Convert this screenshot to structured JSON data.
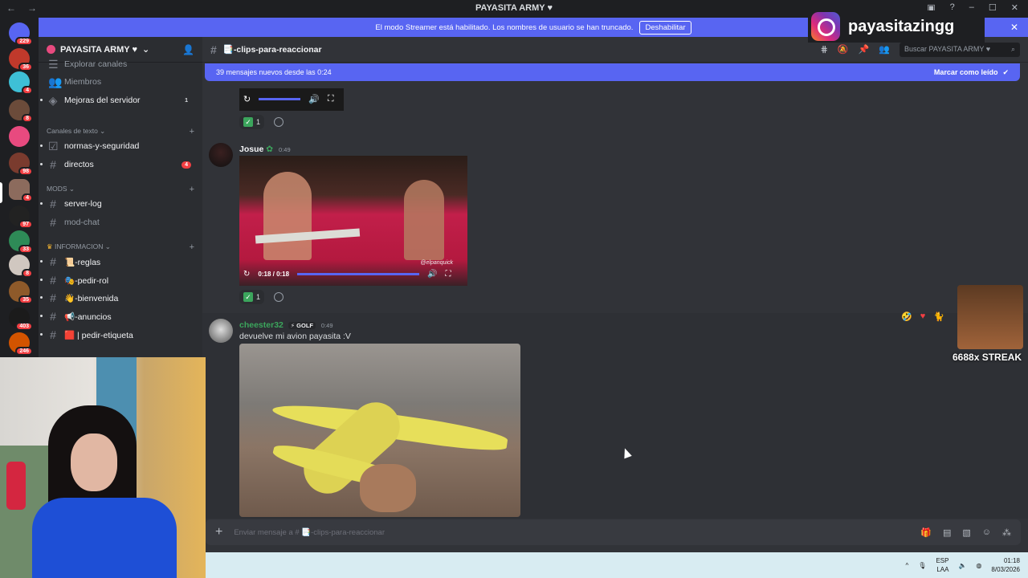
{
  "titlebar": {
    "back": "←",
    "forward": "→",
    "title": "PAYASITA ARMY ♥"
  },
  "streamer_bar": {
    "message": "El modo Streamer está habilitado. Los nombres de usuario se han truncado.",
    "button": "Deshabilitar"
  },
  "guilds": [
    {
      "badge": "229"
    },
    {
      "badge": "36"
    },
    {
      "badge": "4"
    },
    {
      "badge": "8"
    },
    {
      "badge": ""
    },
    {
      "badge": "98"
    },
    {
      "badge": "4"
    },
    {
      "badge": "97"
    },
    {
      "badge": "33"
    },
    {
      "badge": "8"
    },
    {
      "badge": "35"
    },
    {
      "badge": "403"
    },
    {
      "badge": "246"
    }
  ],
  "server": {
    "name": "PAYASITA ARMY ♥"
  },
  "channels": {
    "explore": "Explorar canales",
    "members": "Miembros",
    "boosts": "Mejoras del servidor",
    "boosts_count": "1",
    "cat_text": "Canales de texto",
    "normas": "normas-y-seguridad",
    "directos": "directos",
    "directos_count": "4",
    "cat_mods": "MODS",
    "server_log": "server-log",
    "mod_chat": "mod-chat",
    "cat_info": "INFORMACION",
    "reglas": "📜-reglas",
    "pedir_rol": "🎭-pedir-rol",
    "bienvenida": "👋-bienvenida",
    "anuncios": "📢-anuncios",
    "pedir_etiqueta": "🟥 | pedir-etiqueta"
  },
  "header": {
    "channel": "📑-clips-para-reaccionar",
    "search_placeholder": "Buscar PAYASITA ARMY ♥"
  },
  "new_messages": {
    "text": "39 mensajes nuevos desde las 0:24",
    "mark_read": "Marcar como leído"
  },
  "messages": [
    {
      "reaction_count": "1"
    },
    {
      "author": "Josue",
      "time": "0:49",
      "video_time": "0:18 / 0:18",
      "video_watermark": "@elpanquick",
      "reaction_count": "1"
    },
    {
      "author": "cheester32",
      "tag": "⚡ GOLF",
      "time": "0:49",
      "text": "devuelve mi avion payasita :V"
    }
  ],
  "composer": {
    "placeholder": "Enviar mensaje a # 📑-clips-para-reaccionar"
  },
  "overlay": {
    "instagram": "payasitazingg",
    "streak": "6688x STREAK"
  },
  "taskbar": {
    "lang_1": "ESP",
    "lang_2": "LAA",
    "time": "01:18",
    "date": "8/03/2026"
  },
  "colors": {
    "accent": "#5865f2",
    "background": "#313338",
    "sidebar": "#2b2d31",
    "badge_red": "#f23f43",
    "check_green": "#3ba55c"
  }
}
